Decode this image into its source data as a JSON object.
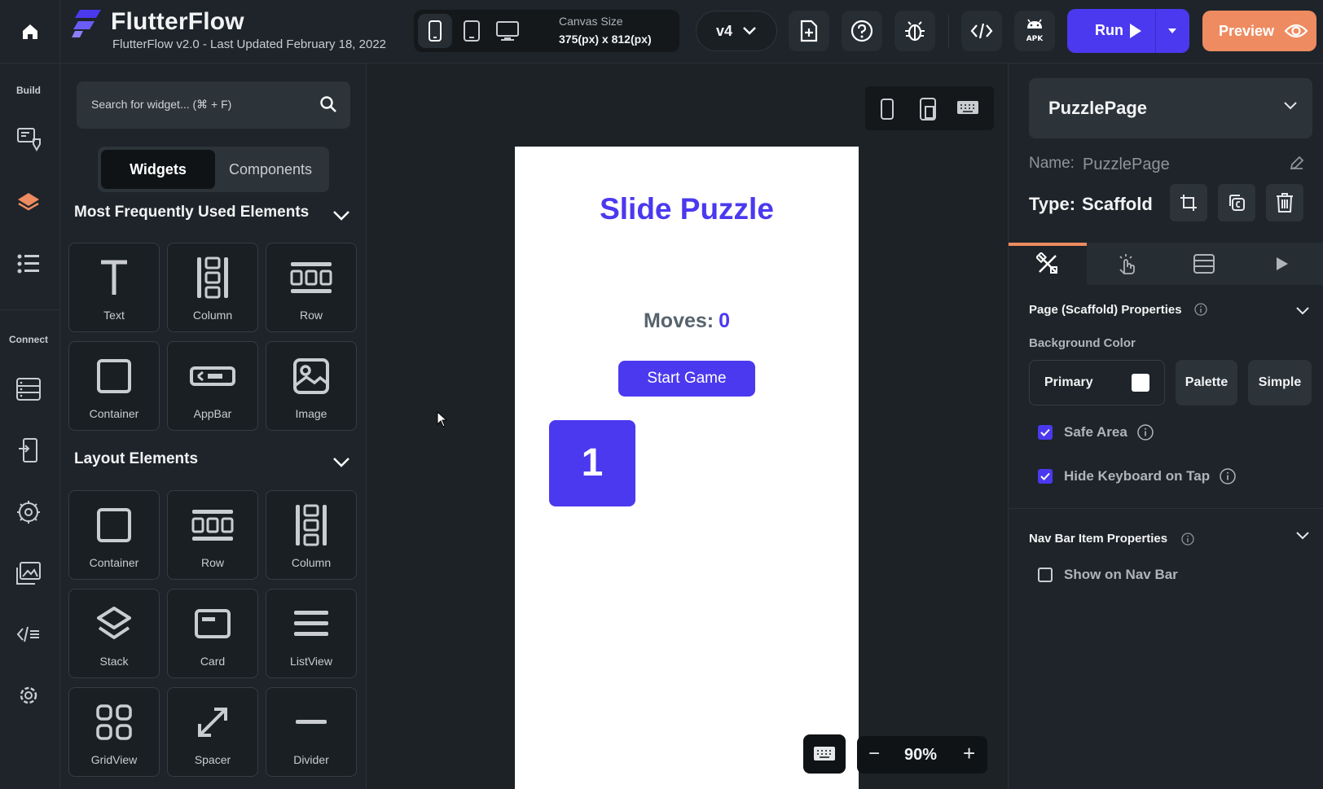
{
  "app": {
    "name": "FlutterFlow",
    "subtitle": "FlutterFlow v2.0 - Last Updated February 18, 2022"
  },
  "topbar": {
    "canvas_size_label": "Canvas Size",
    "canvas_size_value": "375(px) x 812(px)",
    "version": "v4",
    "run_label": "Run",
    "preview_label": "Preview",
    "accent_color": "#4b39ef",
    "preview_color": "#ee8b60"
  },
  "rail": {
    "build_label": "Build",
    "connect_label": "Connect"
  },
  "panel": {
    "search_placeholder": "Search for widget... (⌘ + F)",
    "tabs": [
      "Widgets",
      "Components"
    ],
    "sections": [
      {
        "title": "Most Frequently Used Elements",
        "items": [
          "Text",
          "Column",
          "Row",
          "Container",
          "AppBar",
          "Image"
        ]
      },
      {
        "title": "Layout Elements",
        "items": [
          "Container",
          "Row",
          "Column",
          "Stack",
          "Card",
          "ListView",
          "GridView",
          "Spacer",
          "Divider"
        ]
      }
    ]
  },
  "canvas": {
    "page_title": "Slide Puzzle",
    "moves_label": "Moves:",
    "moves_value": "0",
    "start_button": "Start Game",
    "tile_number": "1",
    "zoom": "90%",
    "zoom_minus": "−",
    "zoom_plus": "+"
  },
  "properties": {
    "page_name": "PuzzlePage",
    "name_label": "Name:",
    "name_value": "PuzzlePage",
    "type_label": "Type:",
    "type_value": "Scaffold",
    "page_props_title": "Page (Scaffold) Properties",
    "background_color_label": "Background Color",
    "background_color_name": "Primary",
    "palette_button": "Palette",
    "simple_button": "Simple",
    "safe_area_label": "Safe Area",
    "safe_area_checked": true,
    "hide_keyboard_label": "Hide Keyboard on Tap",
    "hide_keyboard_checked": true,
    "nav_bar_title": "Nav Bar Item Properties",
    "show_on_nav_label": "Show on Nav Bar",
    "show_on_nav_checked": false
  }
}
